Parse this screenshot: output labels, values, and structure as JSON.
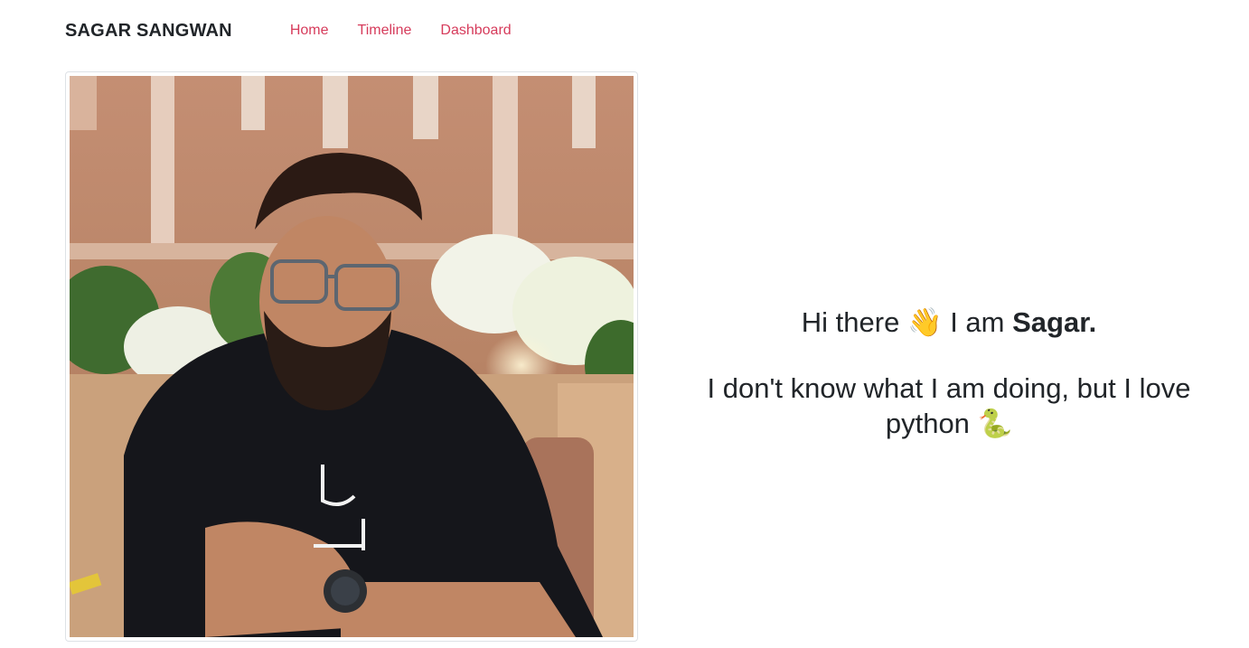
{
  "navbar": {
    "brand": "SAGAR SANGWAN",
    "links": [
      "Home",
      "Timeline",
      "Dashboard"
    ]
  },
  "hero": {
    "greeting_prefix": "Hi there",
    "wave_emoji": "👋",
    "greeting_middle": "I am",
    "name": "Sagar.",
    "tagline": "I don't know what I am doing, but I love python",
    "snake_emoji": "🐍"
  },
  "colors": {
    "link": "#d63b5b",
    "text": "#212529"
  }
}
